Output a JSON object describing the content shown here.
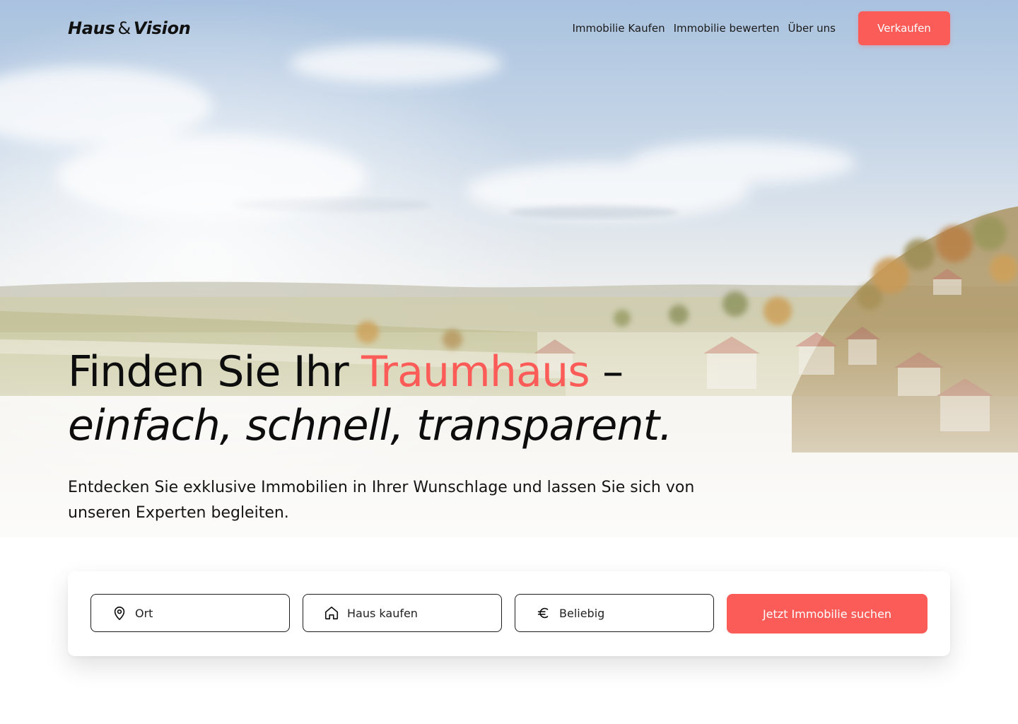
{
  "brand": {
    "name_part1": "Haus",
    "ampersand": "&",
    "name_part2": "Vision"
  },
  "nav": {
    "items": [
      {
        "label": "Immobilie Kaufen"
      },
      {
        "label": "Immobilie bewerten"
      },
      {
        "label": "Über uns"
      }
    ],
    "cta_label": "Verkaufen"
  },
  "hero": {
    "headline_prefix": "Finden Sie Ihr",
    "headline_accent": "Traumhaus",
    "headline_suffix": "–",
    "headline_line2": "einfach, schnell, transparent.",
    "subtitle": "Entdecken Sie exklusive Immobilien in Ihrer Wunschlage und lassen Sie sich von unseren Experten begleiten."
  },
  "search": {
    "location": {
      "value": "Ort",
      "icon": "map-pin-icon"
    },
    "property_type": {
      "value": "Haus kaufen",
      "icon": "house-icon"
    },
    "price": {
      "value": "Beliebig",
      "icon": "euro-icon"
    },
    "submit_label": "Jetzt Immobilie suchen"
  },
  "colors": {
    "accent": "#fc5c58",
    "text": "#111111",
    "background": "#ffffff"
  }
}
